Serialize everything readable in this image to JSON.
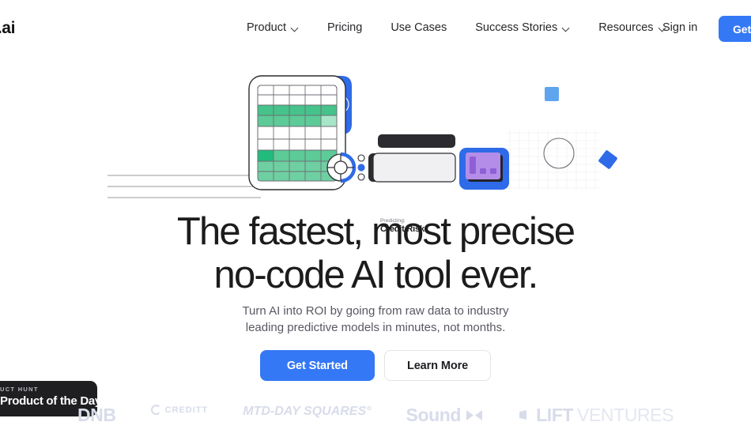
{
  "nav": {
    "logo": "usly.ai",
    "links": [
      {
        "label": "Product",
        "has_dropdown": true
      },
      {
        "label": "Pricing",
        "has_dropdown": false
      },
      {
        "label": "Use Cases",
        "has_dropdown": false
      },
      {
        "label": "Success Stories",
        "has_dropdown": true
      },
      {
        "label": "Resources",
        "has_dropdown": true
      }
    ],
    "signin": "Sign in",
    "cta": "Get St"
  },
  "illustration": {
    "predicting_label": "Predicting:",
    "predicting_value": "Credit Risk",
    "colors": {
      "blue": "#2F6BE8",
      "green": "#46C38A",
      "green_light": "#7FD9AE",
      "green_pale": "#A9E5C8",
      "green_dark": "#22BB7E",
      "purple": "#B48DE8",
      "sky": "#5FA5EE",
      "line": "#9a9aa2"
    }
  },
  "hero": {
    "headline_line1": "The fastest, most precise",
    "headline_line2": "no-code AI tool ever.",
    "subheadline_line1": "Turn AI into ROI by going from raw data to industry",
    "subheadline_line2": "leading predictive models in minutes, not months.",
    "cta_primary": "Get Started",
    "cta_secondary": "Learn More"
  },
  "product_hunt_badge": {
    "kicker": "UCT HUNT",
    "title": "Product of the Day"
  },
  "partners": [
    {
      "name": "DNB",
      "style": "bold"
    },
    {
      "name": "CREDITT",
      "style": "small"
    },
    {
      "name": "MTD-DAY SQUARES°",
      "style": "italic"
    },
    {
      "name": "Sound",
      "style": "bold"
    },
    {
      "name": "LIFT",
      "style": "bold",
      "suffix": "VENTURES"
    }
  ],
  "theme": {
    "accent": "#3478F6",
    "text": "#1c1c1c",
    "muted": "#585862",
    "badge_bg": "#1f1f22",
    "partner_gray": "#d8dcea"
  }
}
